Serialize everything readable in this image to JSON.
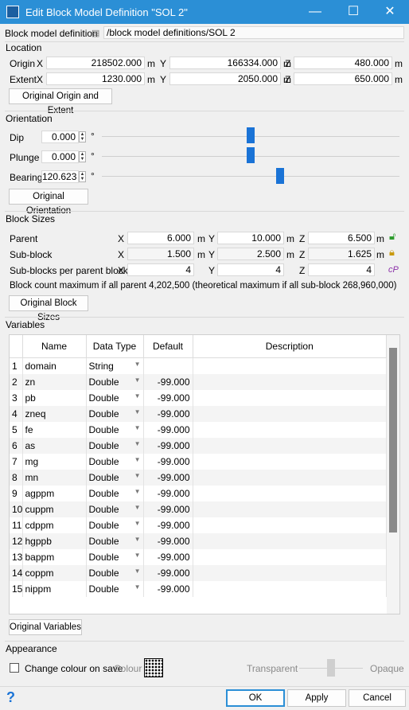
{
  "window": {
    "title": "Edit Block Model Definition \"SOL 2\"",
    "minimize": "—",
    "maximize": "☐",
    "close": "✕"
  },
  "definition": {
    "label": "Block model definition",
    "path": "/block model definitions/SOL 2"
  },
  "location": {
    "title": "Location",
    "origin_label": "Origin",
    "extent_label": "Extent",
    "x_label": "X",
    "y_label": "Y",
    "z_label": "Z",
    "unit": "m",
    "origin": {
      "x": "218502.000",
      "y": "166334.000",
      "z": "480.000"
    },
    "extent": {
      "x": "1230.000",
      "y": "2050.000",
      "z": "650.000"
    },
    "reset_button": "Original Origin and Extent"
  },
  "orientation": {
    "title": "Orientation",
    "degree": "°",
    "dip": {
      "label": "Dip",
      "value": "0.000",
      "level": 0.5
    },
    "plunge": {
      "label": "Plunge",
      "value": "0.000",
      "level": 0.5
    },
    "bearing": {
      "label": "Bearing",
      "value": "120.623",
      "level": 0.6
    },
    "reset_button": "Original Orientation"
  },
  "block_sizes": {
    "title": "Block Sizes",
    "x_label": "X",
    "y_label": "Y",
    "z_label": "Z",
    "unit": "m",
    "parent": {
      "label": "Parent",
      "x": "6.000",
      "y": "10.000",
      "z": "6.500"
    },
    "sub_block": {
      "label": "Sub-block",
      "x": "1.500",
      "y": "2.500",
      "z": "1.625"
    },
    "per_parent": {
      "label": "Sub-blocks per parent block",
      "x": "4",
      "y": "4",
      "z": "4"
    },
    "count_note": "Block count maximum if all parent 4,202,500 (theoretical maximum if all sub-block 268,960,000)",
    "reset_button": "Original Block Sizes"
  },
  "variables": {
    "title": "Variables",
    "columns": [
      "Name",
      "Data Type",
      "Default",
      "Description"
    ],
    "rows": [
      {
        "n": "1",
        "name": "domain",
        "type": "String",
        "default": "",
        "desc": ""
      },
      {
        "n": "2",
        "name": "zn",
        "type": "Double",
        "default": "-99.000",
        "desc": ""
      },
      {
        "n": "3",
        "name": "pb",
        "type": "Double",
        "default": "-99.000",
        "desc": ""
      },
      {
        "n": "4",
        "name": "zneq",
        "type": "Double",
        "default": "-99.000",
        "desc": ""
      },
      {
        "n": "5",
        "name": "fe",
        "type": "Double",
        "default": "-99.000",
        "desc": ""
      },
      {
        "n": "6",
        "name": "as",
        "type": "Double",
        "default": "-99.000",
        "desc": ""
      },
      {
        "n": "7",
        "name": "mg",
        "type": "Double",
        "default": "-99.000",
        "desc": ""
      },
      {
        "n": "8",
        "name": "mn",
        "type": "Double",
        "default": "-99.000",
        "desc": ""
      },
      {
        "n": "9",
        "name": "agppm",
        "type": "Double",
        "default": "-99.000",
        "desc": ""
      },
      {
        "n": "10",
        "name": "cuppm",
        "type": "Double",
        "default": "-99.000",
        "desc": ""
      },
      {
        "n": "11",
        "name": "cdppm",
        "type": "Double",
        "default": "-99.000",
        "desc": ""
      },
      {
        "n": "12",
        "name": "hgppb",
        "type": "Double",
        "default": "-99.000",
        "desc": ""
      },
      {
        "n": "13",
        "name": "bappm",
        "type": "Double",
        "default": "-99.000",
        "desc": ""
      },
      {
        "n": "14",
        "name": "coppm",
        "type": "Double",
        "default": "-99.000",
        "desc": ""
      },
      {
        "n": "15",
        "name": "nippm",
        "type": "Double",
        "default": "-99.000",
        "desc": ""
      }
    ],
    "reset_button": "Original Variables"
  },
  "appearance": {
    "title": "Appearance",
    "change_colour_label": "Change colour on save",
    "colour_label": "Colour",
    "transparent_label": "Transparent",
    "opaque_label": "Opaque"
  },
  "footer": {
    "help": "?",
    "ok": "OK",
    "apply": "Apply",
    "cancel": "Cancel"
  }
}
